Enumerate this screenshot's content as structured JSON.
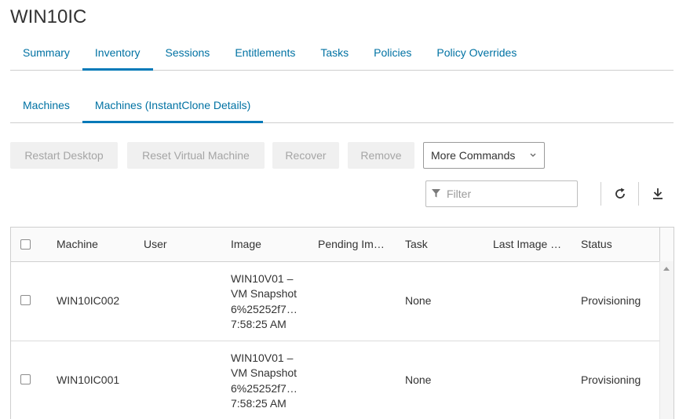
{
  "page": {
    "title": "WIN10IC"
  },
  "main_tabs": [
    {
      "label": "Summary"
    },
    {
      "label": "Inventory"
    },
    {
      "label": "Sessions"
    },
    {
      "label": "Entitlements"
    },
    {
      "label": "Tasks"
    },
    {
      "label": "Policies"
    },
    {
      "label": "Policy Overrides"
    }
  ],
  "sub_tabs": [
    {
      "label": "Machines"
    },
    {
      "label": "Machines (InstantClone Details)"
    }
  ],
  "toolbar": {
    "restart": "Restart Desktop",
    "reset": "Reset Virtual Machine",
    "recover": "Recover",
    "remove": "Remove",
    "more": "More Commands"
  },
  "filter": {
    "placeholder": "Filter"
  },
  "icons": {
    "filter": "filter-funnel-icon",
    "refresh": "refresh-icon",
    "export": "download-icon",
    "dropdown": "chevron-down-icon"
  },
  "colors": {
    "accent": "#0079b8",
    "link": "#0072a3",
    "disabled_text": "#a5a5a5"
  },
  "table": {
    "columns": [
      "Machine",
      "User",
      "Image",
      "Pending Im…",
      "Task",
      "Last Image …",
      "Status"
    ],
    "rows": [
      {
        "machine": "WIN10IC002",
        "user": "",
        "image": [
          "WIN10V01 –",
          "VM Snapshot",
          "6%25252f7…",
          "7:58:25 AM"
        ],
        "pending": "",
        "task": "None",
        "last_image": "",
        "status": "Provisioning"
      },
      {
        "machine": "WIN10IC001",
        "user": "",
        "image": [
          "WIN10V01 –",
          "VM Snapshot",
          "6%25252f7…",
          "7:58:25 AM"
        ],
        "pending": "",
        "task": "None",
        "last_image": "",
        "status": "Provisioning"
      }
    ]
  }
}
